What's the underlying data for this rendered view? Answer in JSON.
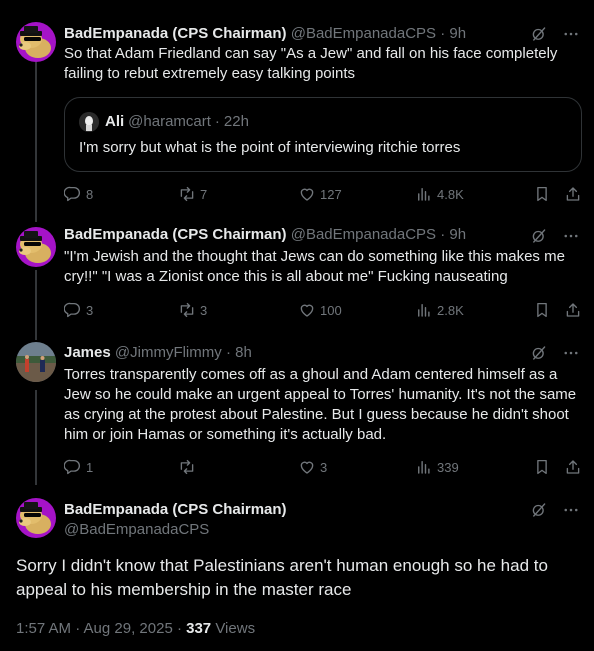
{
  "posts": [
    {
      "author_name": "BadEmpanada (CPS Chairman)",
      "handle": "@BadEmpanadaCPS",
      "time": "9h",
      "text": "So that Adam Friedland can say \"As a Jew\" and fall on his face completely failing to rebut extremely easy talking points",
      "quote": {
        "author_name": "Ali",
        "handle": "@haramcart",
        "time": "22h",
        "text": "I'm sorry but what is the point of interviewing ritchie torres"
      },
      "replies": "8",
      "reposts": "7",
      "likes": "127",
      "views": "4.8K"
    },
    {
      "author_name": "BadEmpanada (CPS Chairman)",
      "handle": "@BadEmpanadaCPS",
      "time": "9h",
      "text": "\"I'm Jewish and the thought that Jews can do something like this makes me cry!!\" \"I was a Zionist once this is all about me\" Fucking nauseating",
      "replies": "3",
      "reposts": "3",
      "likes": "100",
      "views": "2.8K"
    },
    {
      "author_name": "James",
      "handle": "@JimmyFlimmy",
      "time": "8h",
      "text": "Torres transparently comes off as a ghoul and Adam centered himself as a Jew so he could make an urgent appeal to Torres' humanity. It's not the same as crying at the protest about Palestine. But I guess because he didn't shoot him or join Hamas or something it's actually bad.",
      "replies": "1",
      "reposts": "",
      "likes": "3",
      "views": "339"
    }
  ],
  "focus": {
    "author_name": "BadEmpanada (CPS Chairman)",
    "handle": "@BadEmpanadaCPS",
    "text": "Sorry I didn't know that Palestinians aren't human enough so he had to appeal to his membership in the master race",
    "timestamp": "1:57 AM · Aug 29, 2025 · ",
    "views_count": "337",
    "views_label": " Views"
  },
  "separator": "·",
  "icons": {
    "reply": "reply-icon",
    "repost": "repost-icon",
    "like": "heart-icon",
    "views": "views-chart-icon",
    "bookmark": "bookmark-icon",
    "share": "share-icon",
    "grok": "grok-icon",
    "more": "more-icon"
  },
  "colors": {
    "background": "#000000",
    "text": "#e7e9ea",
    "muted": "#71767b",
    "border": "#2f3336",
    "avatar_bg": "#a513c7"
  }
}
